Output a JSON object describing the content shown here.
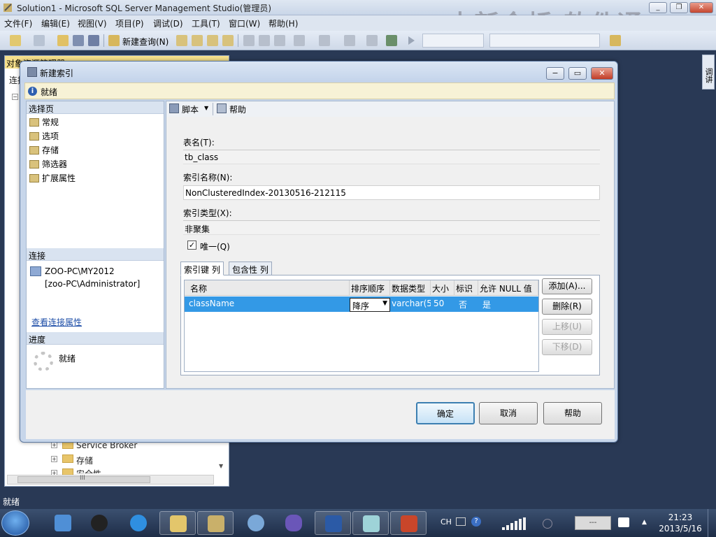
{
  "main_window": {
    "title": "Solution1 - Microsoft SQL Server Management Studio(管理员)",
    "watermark": "中新金桥 软件通",
    "menu": [
      "文件(F)",
      "编辑(E)",
      "视图(V)",
      "项目(P)",
      "调试(D)",
      "工具(T)",
      "窗口(W)",
      "帮助(H)"
    ],
    "toolbar_new_query": "新建查询(N)",
    "status": "就绪"
  },
  "object_explorer": {
    "title": "对象资源管理器",
    "connect_label": "连接",
    "items": [
      {
        "label": "Service Broker"
      },
      {
        "label": "存储"
      },
      {
        "label": "安全性"
      }
    ],
    "scroll_glyph": "III"
  },
  "right_strip_label": "调讲",
  "dialog": {
    "title": "新建索引",
    "info": "就绪",
    "left": {
      "select_page_header": "选择页",
      "pages": [
        "常规",
        "选项",
        "存储",
        "筛选器",
        "扩展属性"
      ],
      "connection_header": "连接",
      "connection_lines": [
        "ZOO-PC\\MY2012",
        "[zoo-PC\\Administrator]"
      ],
      "view_conn_props": "查看连接属性",
      "progress_header": "进度",
      "progress_status": "就绪"
    },
    "toolbar": {
      "script": "脚本",
      "help": "帮助"
    },
    "form": {
      "table_name_label": "表名(T):",
      "table_name": "tb_class",
      "index_name_label": "索引名称(N):",
      "index_name": "NonClusteredIndex-20130516-212115",
      "index_type_label": "索引类型(X):",
      "index_type": "非聚集",
      "unique_label": "唯一(Q)",
      "unique_checked": true
    },
    "tabs": [
      "索引键 列",
      "包含性 列"
    ],
    "grid": {
      "headers": [
        "名称",
        "排序顺序",
        "数据类型",
        "大小",
        "标识",
        "允许 NULL 值"
      ],
      "rows": [
        {
          "name": "className",
          "sort": "降序",
          "type": "varchar(5",
          "size": "50",
          "identity": "否",
          "nullable": "是"
        }
      ]
    },
    "side_buttons": {
      "add": "添加(A)...",
      "remove": "删除(R)",
      "up": "上移(U)",
      "down": "下移(D)"
    },
    "footer": {
      "ok": "确定",
      "cancel": "取消",
      "help": "帮助"
    }
  },
  "taskbar": {
    "lang": "CH",
    "time": "21:23",
    "date": "2013/5/16",
    "battery": "---"
  }
}
